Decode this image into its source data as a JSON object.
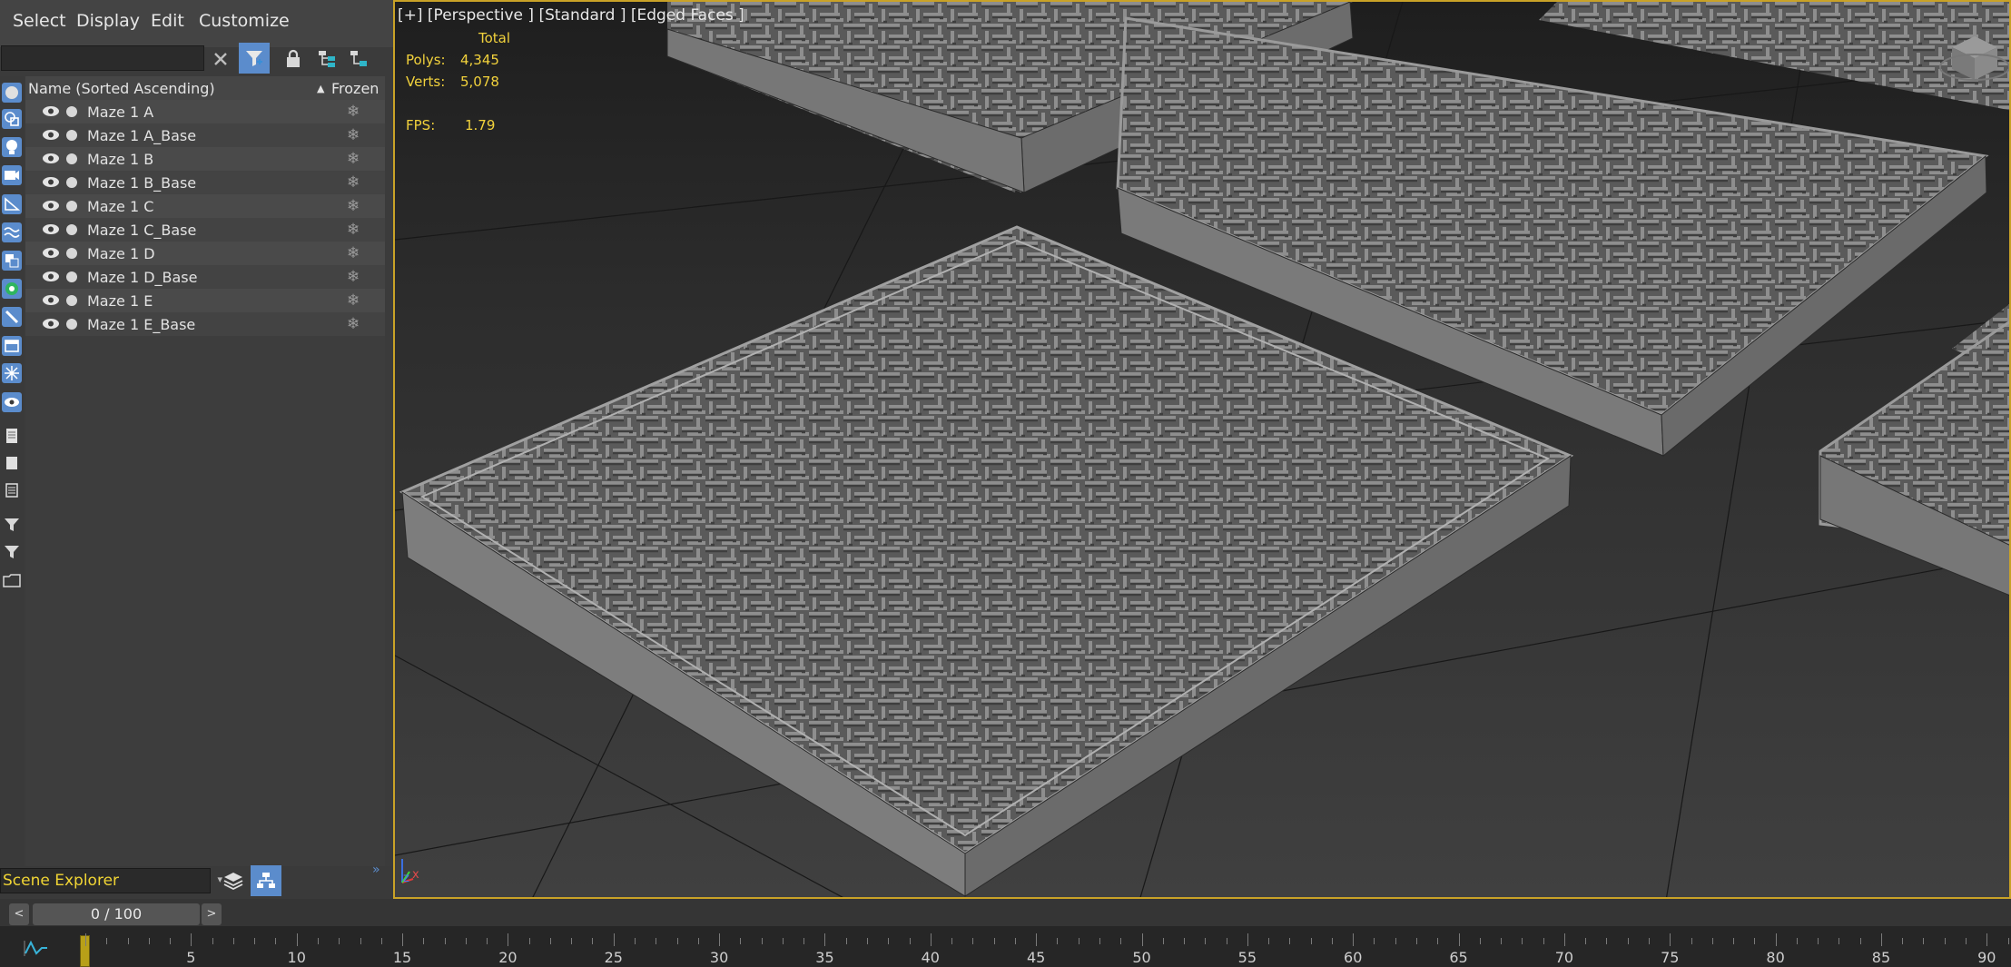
{
  "menu": {
    "items": [
      {
        "label": "Select"
      },
      {
        "label": "Display"
      },
      {
        "label": "Edit"
      },
      {
        "label": "Customize"
      }
    ]
  },
  "explorer": {
    "search_value": "",
    "columns": {
      "name": "Name (Sorted Ascending)",
      "sort_indicator": "▲",
      "frozen": "Frozen"
    },
    "rows": [
      {
        "name": "Maze 1 A"
      },
      {
        "name": "Maze 1 A_Base"
      },
      {
        "name": "Maze 1 B"
      },
      {
        "name": "Maze 1 B_Base"
      },
      {
        "name": "Maze 1 C"
      },
      {
        "name": "Maze 1 C_Base"
      },
      {
        "name": "Maze 1 D"
      },
      {
        "name": "Maze 1 D_Base"
      },
      {
        "name": "Maze 1 E"
      },
      {
        "name": "Maze 1 E_Base"
      }
    ],
    "footer_select": "Scene Explorer"
  },
  "viewport": {
    "label": "[+] [Perspective ] [Standard ] [Edged Faces ]",
    "stats": {
      "total_label": "Total",
      "polys_label": "Polys:",
      "polys_value": "4,345",
      "verts_label": "Verts:",
      "verts_value": "5,078",
      "fps_label": "FPS:",
      "fps_value": "1.79"
    },
    "axis_labels": {
      "x": "x",
      "z": "z"
    }
  },
  "timeline": {
    "frame_display": "0 / 100",
    "prev_symbol": "<",
    "next_symbol": ">",
    "ruler_labels": [
      "5",
      "10",
      "15",
      "20",
      "25",
      "30",
      "35",
      "40",
      "45",
      "50",
      "55",
      "60",
      "65",
      "70",
      "75",
      "80",
      "85",
      "90"
    ]
  },
  "colors": {
    "accent_blue": "#5b8ccc",
    "viewport_border": "#c9a227",
    "stats_yellow": "#f2d23c"
  }
}
